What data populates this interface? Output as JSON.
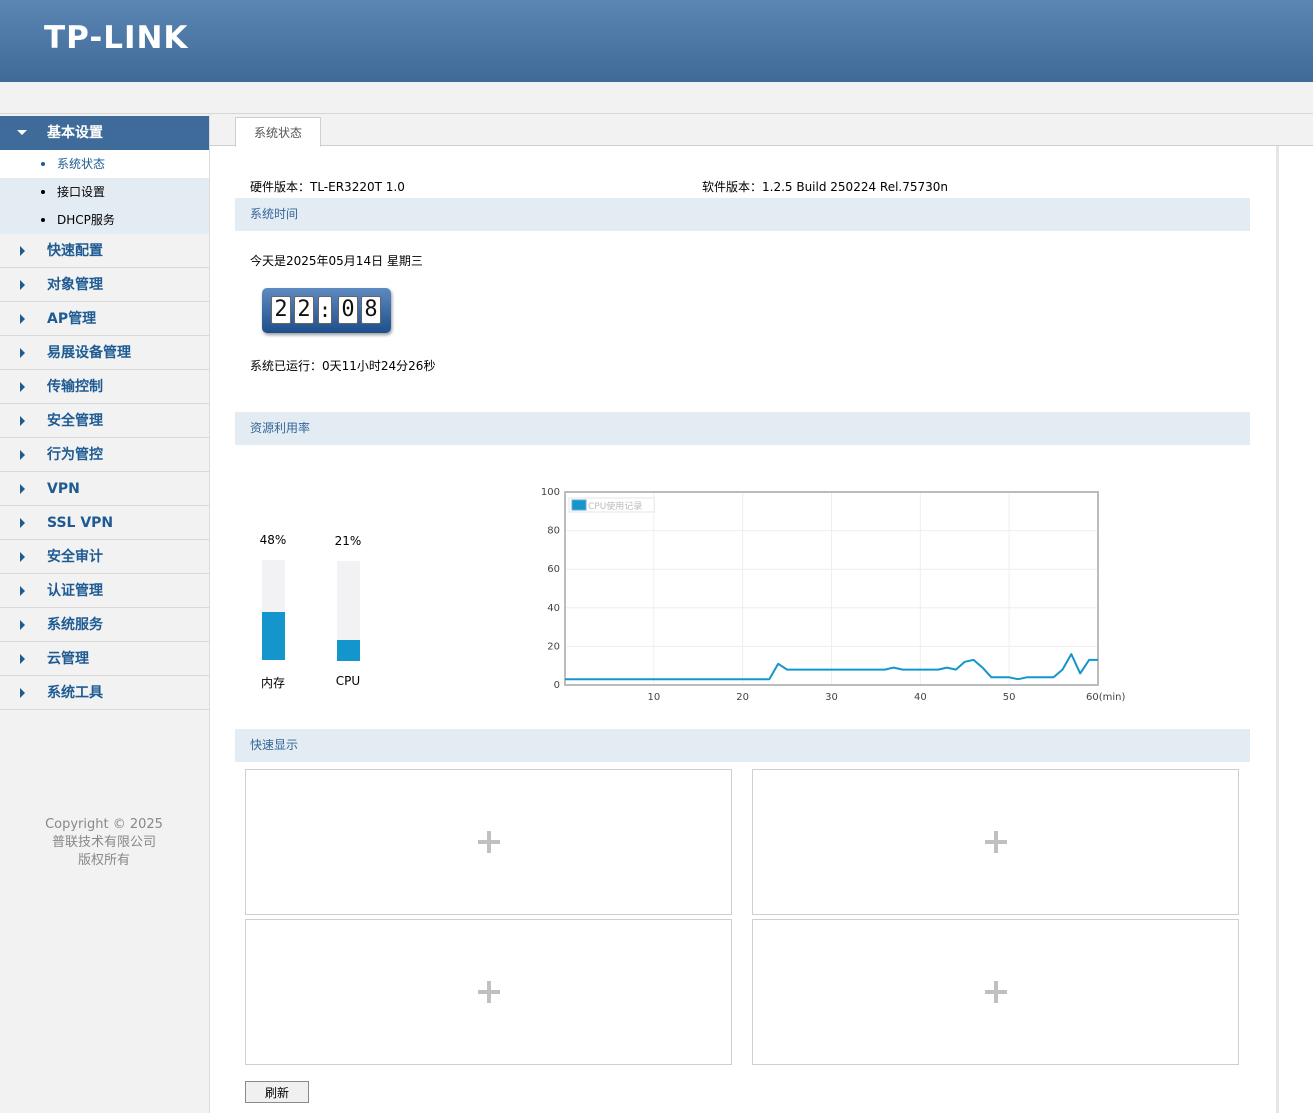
{
  "brand": {
    "logo_text": "TP-LINK"
  },
  "sidebar": {
    "groups": [
      {
        "label": "基本设置",
        "expanded": true,
        "items": [
          {
            "label": "系统状态",
            "active": true
          },
          {
            "label": "接口设置"
          },
          {
            "label": "DHCP服务"
          }
        ]
      },
      {
        "label": "快速配置"
      },
      {
        "label": "对象管理"
      },
      {
        "label": "AP管理"
      },
      {
        "label": "易展设备管理"
      },
      {
        "label": "传输控制"
      },
      {
        "label": "安全管理"
      },
      {
        "label": "行为管控"
      },
      {
        "label": "VPN"
      },
      {
        "label": "SSL VPN"
      },
      {
        "label": "安全审计"
      },
      {
        "label": "认证管理"
      },
      {
        "label": "系统服务"
      },
      {
        "label": "云管理"
      },
      {
        "label": "系统工具"
      }
    ],
    "copyright": [
      "Copyright © 2025",
      "普联技术有限公司",
      "版权所有"
    ]
  },
  "tabs": {
    "active": "系统状态"
  },
  "versions": {
    "hardware": "硬件版本：TL-ER3220T 1.0",
    "software": "软件版本：1.2.5 Build 250224 Rel.75730n"
  },
  "sections": {
    "system_time": "系统时间",
    "resource_usage": "资源利用率",
    "quick_display": "快速显示"
  },
  "system_time": {
    "date_text": "今天是2025年05月14日 星期三",
    "clock": [
      "2",
      "2",
      ":",
      "0",
      "8"
    ],
    "uptime_text": "系统已运行：0天11小时24分26秒"
  },
  "resources": {
    "memory": {
      "label": "内存",
      "percent_text": "48%",
      "value": 48
    },
    "cpu": {
      "label": "CPU",
      "percent_text": "21%",
      "value": 21
    }
  },
  "colors": {
    "accent": "#1496cc",
    "nav_active": "#3f6b9a",
    "nav_text": "#1f5b93",
    "section_bg": "#e4ecf3"
  },
  "chart_data": {
    "type": "line",
    "legend": "CPU使用记录",
    "xlim": [
      0,
      60
    ],
    "ylim": [
      0,
      100
    ],
    "xticks": [
      10,
      20,
      30,
      40,
      50,
      60
    ],
    "xtick_labels": [
      "10",
      "20",
      "30",
      "40",
      "50",
      "60(min)"
    ],
    "yticks": [
      0,
      20,
      40,
      60,
      80,
      100
    ],
    "ytick_labels": [
      "0",
      "20",
      "40",
      "60",
      "80",
      "100"
    ],
    "grid": true,
    "legend_position": "top-left",
    "series": [
      {
        "name": "CPU使用记录",
        "color": "#1496cc",
        "x": [
          0,
          1,
          2,
          3,
          4,
          5,
          6,
          7,
          8,
          9,
          10,
          11,
          12,
          13,
          14,
          15,
          16,
          17,
          18,
          19,
          20,
          21,
          22,
          23,
          24,
          25,
          26,
          27,
          28,
          29,
          30,
          31,
          32,
          33,
          34,
          35,
          36,
          37,
          38,
          39,
          40,
          41,
          42,
          43,
          44,
          45,
          46,
          47,
          48,
          49,
          50,
          51,
          52,
          53,
          54,
          55,
          56,
          57,
          58,
          59,
          60
        ],
        "y": [
          3,
          3,
          3,
          3,
          3,
          3,
          3,
          3,
          3,
          3,
          3,
          3,
          3,
          3,
          3,
          3,
          3,
          3,
          3,
          3,
          3,
          3,
          3,
          3,
          11,
          8,
          8,
          8,
          8,
          8,
          8,
          8,
          8,
          8,
          8,
          8,
          8,
          9,
          8,
          8,
          8,
          8,
          8,
          9,
          8,
          12,
          13,
          9,
          4,
          4,
          4,
          3,
          4,
          4,
          4,
          4,
          8,
          16,
          6,
          13,
          13
        ]
      }
    ]
  },
  "buttons": {
    "refresh": "刷新"
  }
}
